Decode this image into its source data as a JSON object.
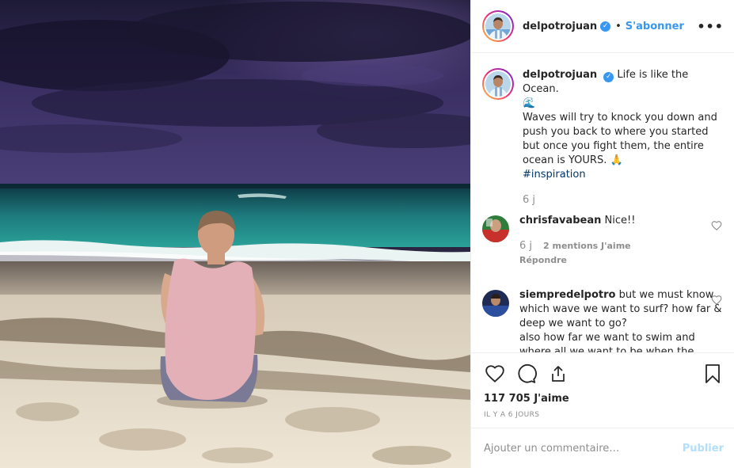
{
  "post": {
    "username": "delpotrojuan",
    "verified": true,
    "separator": "•",
    "follow_label": "S'abonner",
    "more_label": "•••"
  },
  "caption": {
    "username": "delpotrojuan",
    "line1": "Life is like the Ocean.",
    "wave_emoji": "🌊",
    "body": "Waves will try to knock you down and push you back to where you started but once you fight them, the entire ocean is YOURS. 🙏",
    "hashtag": "#inspiration",
    "time": "6 j"
  },
  "comments": [
    {
      "username": "chrisfavabean",
      "text": "Nice!!",
      "time": "6 j",
      "likes": "2 mentions J'aime",
      "reply": "Répondre"
    },
    {
      "username": "siempredelpotro",
      "text": "but we must know which wave we want to surf? how far & deep we want to go?",
      "text2": "also how far we want to swim and where all we want to be when the"
    }
  ],
  "stats": {
    "like_count": "117 705 J'aime",
    "date": "IL Y A 6 JOURS"
  },
  "add_comment": {
    "placeholder": "Ajouter un commentaire…",
    "publish_label": "Publier"
  },
  "colors": {
    "accent": "#3897f0",
    "hashtag": "#00376b",
    "muted": "#8e8e8e",
    "publish_disabled": "#b2dffc"
  },
  "icons": {
    "like": "heart-icon",
    "comment": "comment-icon",
    "share": "share-icon",
    "save": "bookmark-icon",
    "more": "more-options-icon"
  }
}
